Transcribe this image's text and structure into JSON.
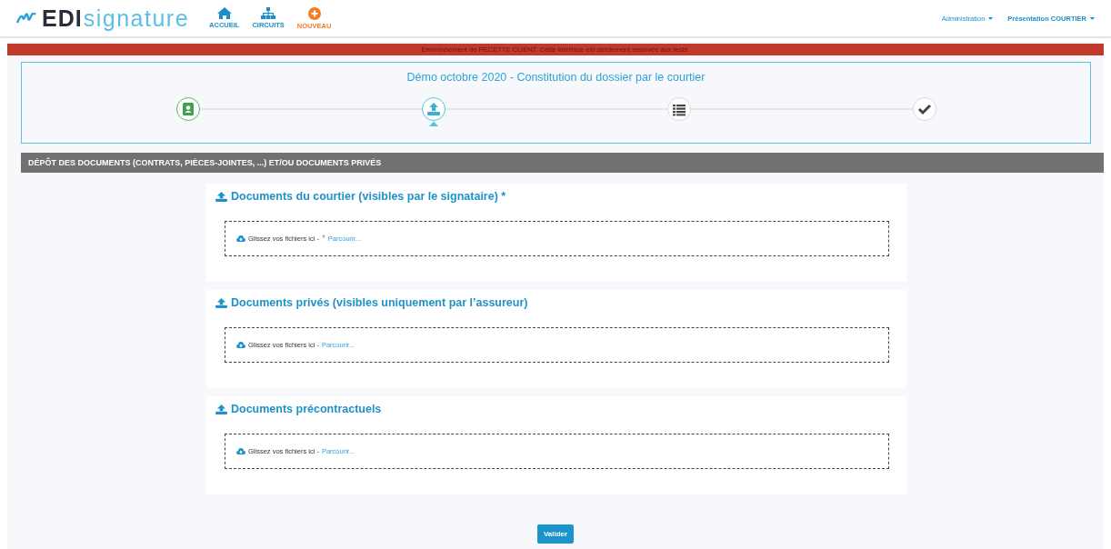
{
  "brand": {
    "strong": "EDI",
    "light": "signature"
  },
  "nav": [
    {
      "label": "ACCUEIL",
      "kind": "home",
      "color": "#1a8fc8"
    },
    {
      "label": "CIRCUITS",
      "kind": "sitemap",
      "color": "#1a8fc8"
    },
    {
      "label": "NOUVEAU",
      "kind": "plus",
      "color": "#f57c22"
    }
  ],
  "menus": [
    {
      "label": "Administration"
    },
    {
      "label": "Présentation COURTIER"
    }
  ],
  "banner": "Environnement de RECETTE CLIENT. Cette interface est strictement réservée aux tests.",
  "workflow": {
    "title": "Démo octobre 2020 - Constitution du dossier par le courtier",
    "steps": [
      {
        "kind": "contact",
        "done": true,
        "selected": false
      },
      {
        "kind": "upload",
        "done": false,
        "selected": true
      },
      {
        "kind": "list",
        "done": false,
        "selected": false
      },
      {
        "kind": "check",
        "done": false,
        "selected": false
      }
    ]
  },
  "section_header": "DÉPÔT DES DOCUMENTS (CONTRATS, PIÈCES-JOINTES, ...) ET/OU DOCUMENTS PRIVÉS",
  "uploads": [
    {
      "title": "Documents du courtier (visibles par le signataire) *",
      "drop_text": "Glissez vos fichiers ici -",
      "required_mark": "*",
      "browse": "Parcourir..."
    },
    {
      "title": "Documents privés (visibles uniquement par l’assureur)",
      "drop_text": "Glissez vos fichiers ici -",
      "browse": "Parcourir..."
    },
    {
      "title": "Documents précontractuels",
      "drop_text": "Glissez vos fichiers ici -",
      "browse": "Parcourir..."
    }
  ],
  "submit": "Valider"
}
